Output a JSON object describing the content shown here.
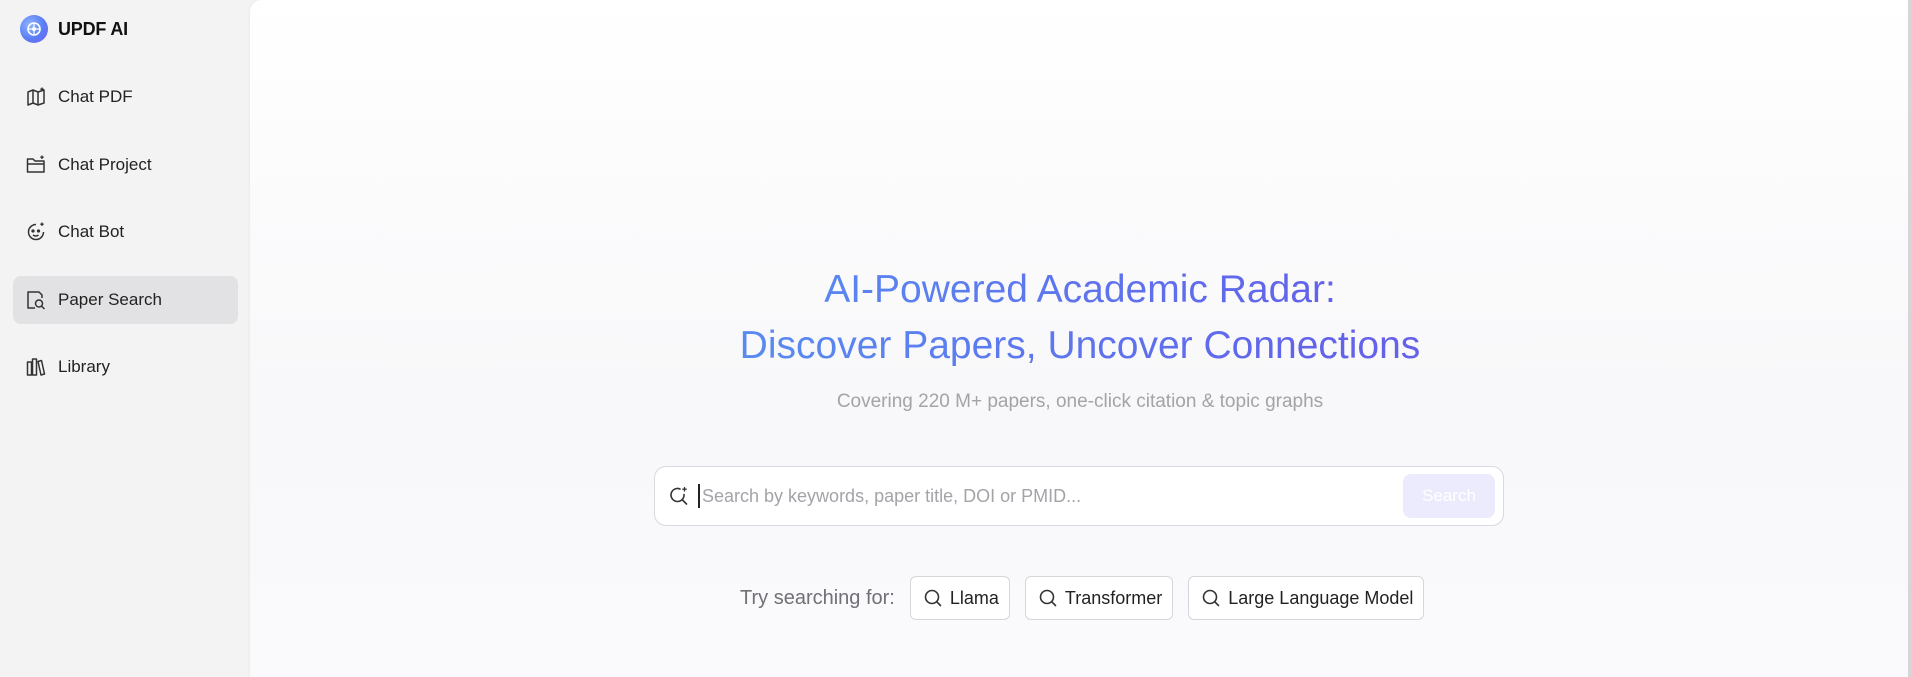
{
  "app": {
    "brand": "UPDF AI",
    "brand_icon": "updf-logo-icon"
  },
  "sidebar": {
    "items": [
      {
        "label": "Chat PDF",
        "icon": "chat-pdf-icon",
        "active": false
      },
      {
        "label": "Chat Project",
        "icon": "chat-project-icon",
        "active": false
      },
      {
        "label": "Chat Bot",
        "icon": "chat-bot-icon",
        "active": false
      },
      {
        "label": "Paper Search",
        "icon": "paper-search-icon",
        "active": true
      },
      {
        "label": "Library",
        "icon": "library-icon",
        "active": false
      }
    ]
  },
  "main": {
    "title_line1": "AI-Powered Academic Radar:",
    "title_line2": "Discover Papers, Uncover Connections",
    "subtitle": "Covering 220 M+ papers, one-click citation & topic graphs",
    "search": {
      "placeholder": "Search by keywords, paper title, DOI or PMID...",
      "value": "",
      "button_label": "Search",
      "icon": "ai-search-icon"
    },
    "suggestions": {
      "label": "Try searching for:",
      "chips": [
        {
          "label": "Llama",
          "icon": "search-icon"
        },
        {
          "label": "Transformer",
          "icon": "search-icon"
        },
        {
          "label": "Large Language Model",
          "icon": "search-icon"
        }
      ]
    }
  },
  "colors": {
    "title_gradient_start": "#4aa3f0",
    "title_gradient_end": "#7d5cf0",
    "active_nav_bg": "#e2e2e4",
    "search_button_bg": "#ecebfd"
  }
}
